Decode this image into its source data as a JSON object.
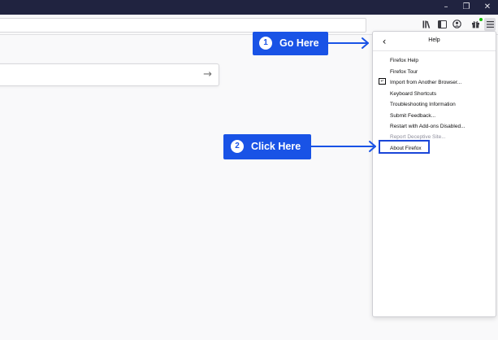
{
  "window_controls": {
    "minimize": "–",
    "restore": "❐",
    "close": "✕"
  },
  "toolbar": {
    "library_icon": "library-icon",
    "sidebar_icon": "sidebar-icon",
    "account_icon": "account-icon",
    "whats_new_icon": "gift-icon",
    "menu_icon": "hamburger-menu-icon",
    "accent": "#12bc00"
  },
  "search": {
    "go_arrow": "→"
  },
  "help_panel": {
    "back": "‹",
    "title": "Help",
    "items": [
      "Firefox Help",
      "Firefox Tour",
      "Import from Another Browser...",
      "Keyboard Shortcuts",
      "Troubleshooting Information",
      "Submit Feedback...",
      "Restart with Add-ons Disabled...",
      "Report Deceptive Site...",
      "About Firefox"
    ]
  },
  "callouts": [
    {
      "number": "1",
      "label": "Go Here"
    },
    {
      "number": "2",
      "label": "Click Here"
    }
  ],
  "colors": {
    "callout": "#1953e6",
    "titlebar": "#202340",
    "highlight": "#1a46d8"
  }
}
